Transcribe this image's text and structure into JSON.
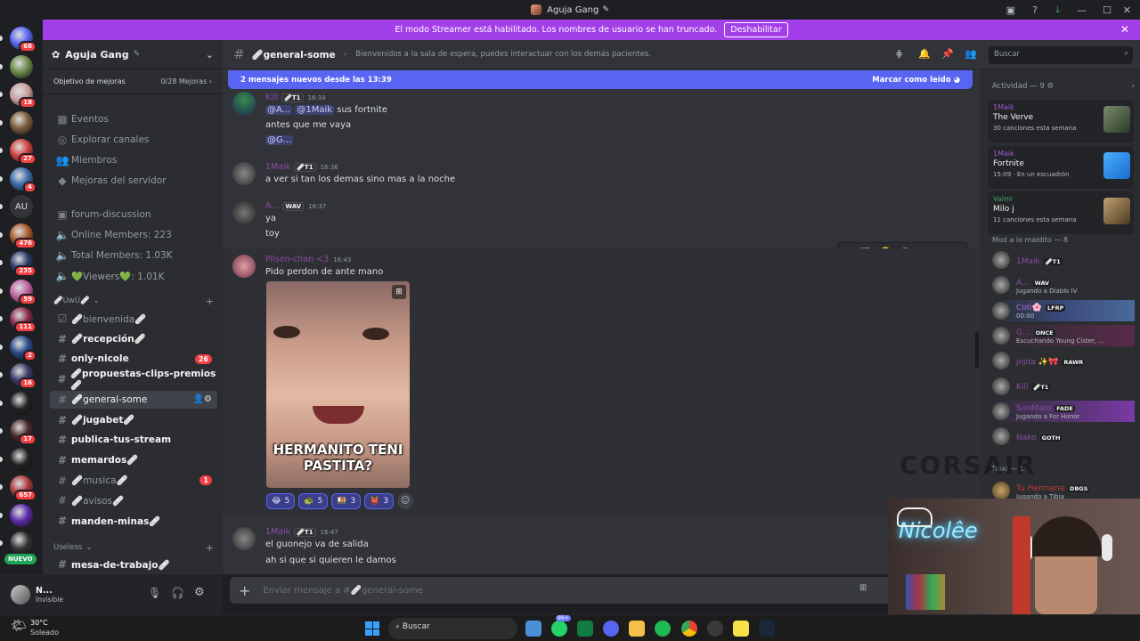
{
  "window": {
    "title": "Aguja Gang"
  },
  "banner": {
    "text": "El modo Streamer está habilitado. Los nombres de usuario se han truncado.",
    "button": "Deshabilitar"
  },
  "servers": [
    {
      "badge": "68"
    },
    {
      "badge": ""
    },
    {
      "badge": "18"
    },
    {
      "badge": ""
    },
    {
      "badge": "27"
    },
    {
      "badge": "4"
    },
    {
      "label": "AU",
      "badge": ""
    },
    {
      "badge": "476"
    },
    {
      "badge": "235"
    },
    {
      "badge": "59"
    },
    {
      "badge": "111"
    },
    {
      "badge": "2"
    },
    {
      "badge": "16"
    },
    {
      "badge": ""
    },
    {
      "badge": "17"
    },
    {
      "badge": ""
    },
    {
      "badge": "657"
    },
    {
      "badge": ""
    },
    {
      "badge": ""
    }
  ],
  "rail": {
    "new_label": "NUEVO"
  },
  "sidebar": {
    "server_name": "Aguja Gang",
    "boost_label": "Objetivo de mejoras",
    "boost_count": "0/28 Mejoras",
    "nav": [
      "Eventos",
      "Explorar canales",
      "Miembros",
      "Mejoras del servidor"
    ],
    "info": [
      "forum-discussion",
      "Online Members: 223",
      "Total Members: 1.03K",
      "💚Viewers💚: 1.01K"
    ],
    "cat1": "🩹UwU🩹",
    "channels": [
      {
        "name": "🩹bienvenida🩹",
        "state": "read",
        "count": ""
      },
      {
        "name": "🩹recepción🩹",
        "state": "unread",
        "count": ""
      },
      {
        "name": "only-nicole",
        "state": "unread",
        "count": "26"
      },
      {
        "name": "🩹propuestas-clips-premios🩹",
        "state": "unread",
        "count": ""
      },
      {
        "name": "🩹general-some",
        "state": "active",
        "count": ""
      },
      {
        "name": "🩹jugabet🩹",
        "state": "unread",
        "count": ""
      },
      {
        "name": "publica-tus-stream",
        "state": "unread",
        "count": ""
      },
      {
        "name": "memardos🩹",
        "state": "unread",
        "count": ""
      },
      {
        "name": "🩹musica🩹",
        "state": "read",
        "count": "1"
      },
      {
        "name": "🩹avisos🩹",
        "state": "read",
        "count": ""
      },
      {
        "name": "manden-minas🩹",
        "state": "unread",
        "count": ""
      }
    ],
    "cat2": "Useless",
    "channel_last": "mesa-de-trabajo🩹"
  },
  "user": {
    "name": "N...",
    "status": "Invisible"
  },
  "chat": {
    "channel": "🩹general-some",
    "topic": "Bienvenidos a la sala de espera, puedes interactuar con los demás pacientes.",
    "new_messages": "2 mensajes nuevos desde las 13:39",
    "mark_read": "Marcar como leído",
    "messages": [
      {
        "user": "Kill",
        "tag": "🩹T1",
        "time": "16:34",
        "m1": "@A...",
        "m2": "@1Maik",
        "rest": " sus fortnite",
        "l2": "antes que me vaya",
        "l3": "@G..."
      },
      {
        "user": "1Maik",
        "tag": "🩹T1",
        "time": "16:36",
        "l1": "a ver si tan los demas sino mas a la noche"
      },
      {
        "user": "A...",
        "tag": "WAV",
        "time": "16:37",
        "l1": "ya",
        "l2": "toy"
      },
      {
        "user": "Pilsen-chan <3",
        "time": "16:43",
        "l1": "Pido perdon de ante mano",
        "meme_text": "HERMANITO TENI PASTITA?"
      },
      {
        "user": "1Maik",
        "tag": "🩹T1",
        "time": "16:47",
        "l1": "el guonejo va de salida",
        "l2": "ah si que si quieren le damos"
      }
    ],
    "reactions": [
      {
        "emoji": "😂",
        "count": "5"
      },
      {
        "emoji": "🐢",
        "count": "5"
      },
      {
        "emoji": "🍱",
        "count": "3"
      },
      {
        "emoji": "👹",
        "count": "3"
      }
    ],
    "composer_placeholder": "Enviar mensaje a #🩹general-some"
  },
  "search": {
    "placeholder": "Buscar"
  },
  "activity": {
    "title": "Actividad — 9",
    "cards": [
      {
        "user": "1Maik",
        "title": "The Verve",
        "sub": "30 canciones esta semana"
      },
      {
        "user": "1Maik",
        "title": "Fortnite",
        "sub": "15:09 · En un escuadrón"
      },
      {
        "user": "Valmi",
        "title": "Milo j",
        "sub": "11 canciones esta semana"
      }
    ],
    "group1": "Mod a lo maldito — 8",
    "members": [
      {
        "name": "1Maik",
        "tag": "🩹T1",
        "status": ""
      },
      {
        "name": "A...",
        "tag": "WAV",
        "status": "Jugando a Diablo IV"
      },
      {
        "name": "Coti🌸",
        "tag": "LFRP",
        "status": "00:00"
      },
      {
        "name": "G...",
        "tag": "ONCE",
        "status": "Escuchando Young Cister, ..."
      },
      {
        "name": "jojita ✨🎀",
        "tag": "RAWR",
        "status": ""
      },
      {
        "name": "Kill",
        "tag": "🩹T1",
        "status": ""
      },
      {
        "name": "SonMato",
        "tag": "FADE",
        "status": "Jugando a For Honor"
      },
      {
        "name": "Nako",
        "tag": "GOTH",
        "status": ""
      }
    ],
    "group2": "Noxi — 1",
    "noxi": {
      "name": "Tu Hermana",
      "tag": "DBGS",
      "status": "Jugando a Tibia"
    }
  },
  "webcam": {
    "neon": "Nicolêe"
  },
  "watermark": "CORSAIR",
  "taskbar": {
    "weather_temp": "30°C",
    "weather_desc": "Soleado",
    "search": "Buscar",
    "badge": "99+"
  }
}
